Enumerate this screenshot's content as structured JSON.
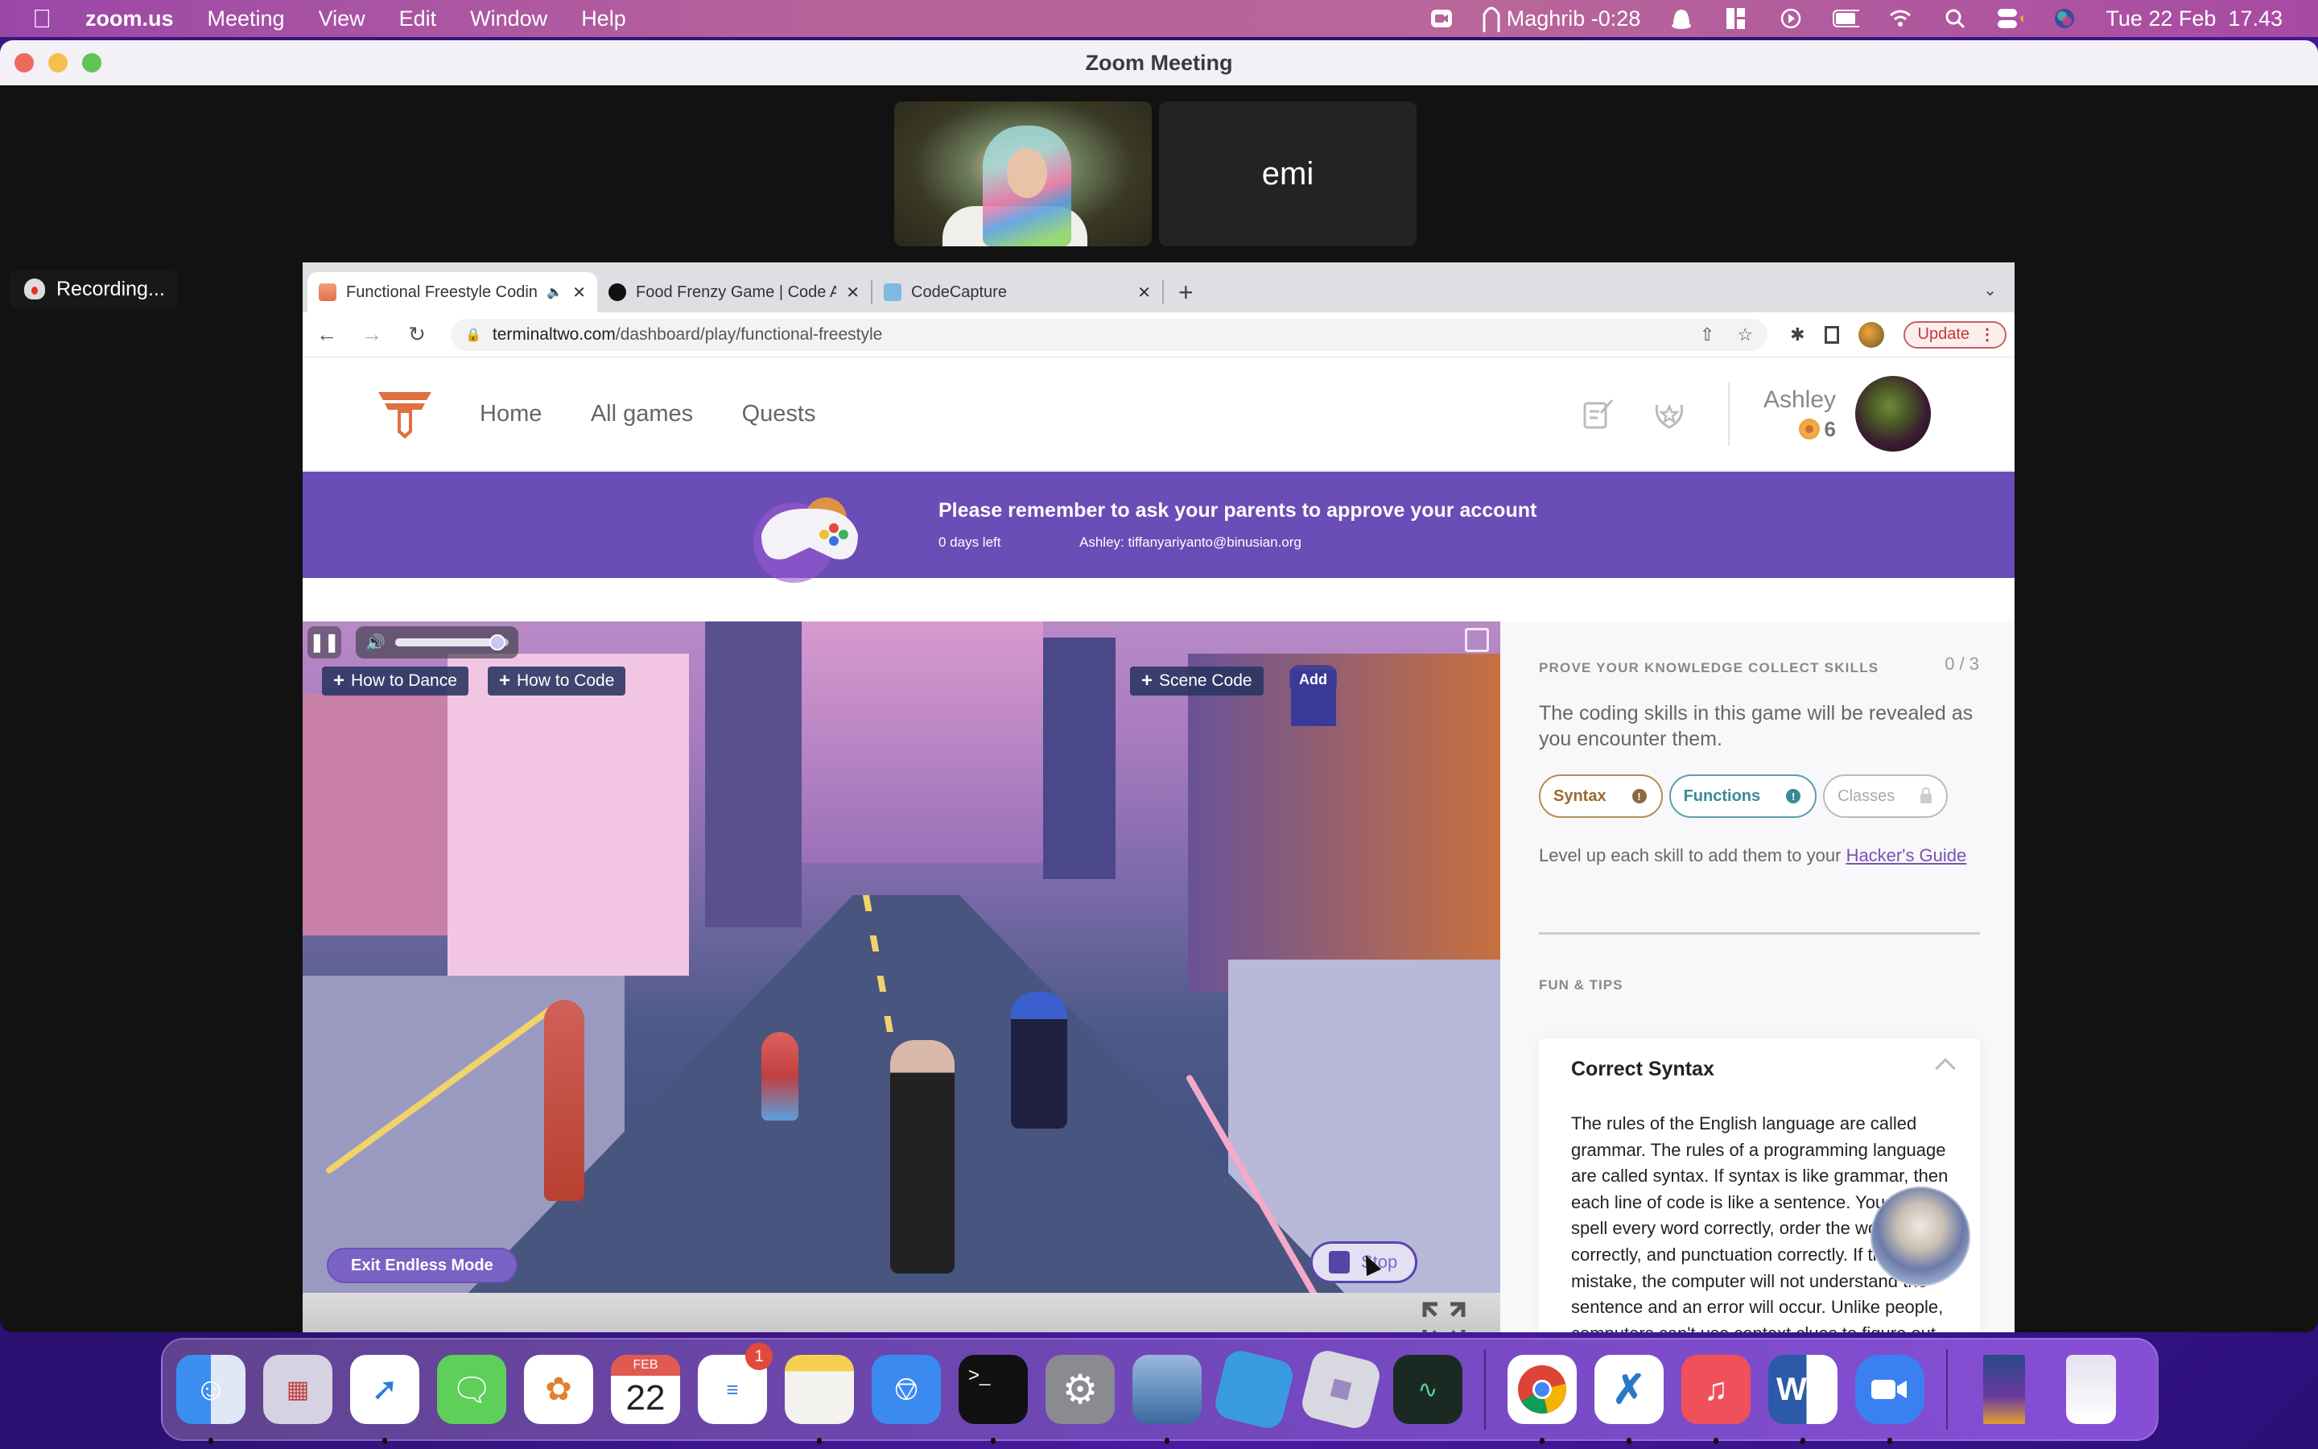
{
  "menubar": {
    "app_name": "zoom.us",
    "menus": [
      "Meeting",
      "View",
      "Edit",
      "Window",
      "Help"
    ],
    "prayer_time": "Maghrib -0:28",
    "datetime": "Tue 22 Feb  17.43",
    "status_icons": [
      "zoom-icon",
      "mosque-icon",
      "notification-bell-icon",
      "layout-icon",
      "play-icon",
      "battery-icon",
      "wifi-icon",
      "search-icon",
      "control-center-icon",
      "siri-icon"
    ]
  },
  "zoom": {
    "window_title": "Zoom Meeting",
    "participant_name": "emi",
    "recording_label": "Recording..."
  },
  "browser": {
    "tabs": [
      {
        "title": "Functional Freestyle Coding",
        "audio": true,
        "active": true
      },
      {
        "title": "Food Frenzy Game | Code Avengers",
        "audio": false,
        "active": false
      },
      {
        "title": "CodeCapture",
        "audio": false,
        "active": false
      }
    ],
    "url_host": "terminaltwo.com",
    "url_path": "/dashboard/play/functional-freestyle",
    "update_label": "Update"
  },
  "site": {
    "nav": [
      "Home",
      "All games",
      "Quests"
    ],
    "user_name": "Ashley",
    "coin_count": "6",
    "banner": {
      "title": "Please remember to ask your parents to approve your account",
      "days_left": "0 days left",
      "account": "Ashley: tiffanyariyanto@binusian.org"
    }
  },
  "game": {
    "buttons": {
      "how_to_dance": "How to Dance",
      "how_to_code": "How to Code",
      "scene_code": "Scene Code",
      "add": "Add",
      "exit_endless": "Exit Endless Mode",
      "stop": "Stop"
    },
    "volume_percent": 90
  },
  "panel": {
    "heading": "PROVE YOUR KNOWLEDGE COLLECT SKILLS",
    "progress": "0 / 3",
    "description": "The coding skills in this game will be revealed as you encounter them.",
    "skills": [
      {
        "name": "Syntax",
        "state": "alert"
      },
      {
        "name": "Functions",
        "state": "alert"
      },
      {
        "name": "Classes",
        "state": "locked"
      }
    ],
    "level_text": "Level up each skill to add them to your ",
    "level_link": "Hacker's Guide",
    "tips_heading": "FUN & TIPS",
    "tip_title": "Correct Syntax",
    "tip_body": "The rules of the English language are called grammar. The rules of a programming language are called syntax. If syntax is like grammar, then each line of code is like a sentence. You have to spell every word correctly, order the words correctly, and punctuation correctly. If there is a mistake, the computer will not understand the sentence and an error will occur. Unlike people, computers can't use context clues to figure out"
  },
  "dock": {
    "calendar_month": "FEB",
    "calendar_day": "22",
    "reminders_badge": "1",
    "apps": [
      "Finder",
      "Launchpad",
      "Safari",
      "Messages",
      "Photos",
      "Calendar",
      "Reminders",
      "Notes",
      "Keynote",
      "Terminal",
      "System Preferences",
      "Preview",
      "Roblox Studio",
      "Roblox",
      "Activity Monitor",
      "Google Chrome",
      "Visual Studio Code",
      "Music",
      "Microsoft Word",
      "Zoom",
      "Document",
      "Trash"
    ]
  },
  "colors": {
    "banner_purple": "#6a4db6",
    "syntax_chip": "#9a6a2e",
    "functions_chip": "#3a8a96",
    "link_purple": "#7a52b0",
    "update_red": "#c03a3a"
  }
}
